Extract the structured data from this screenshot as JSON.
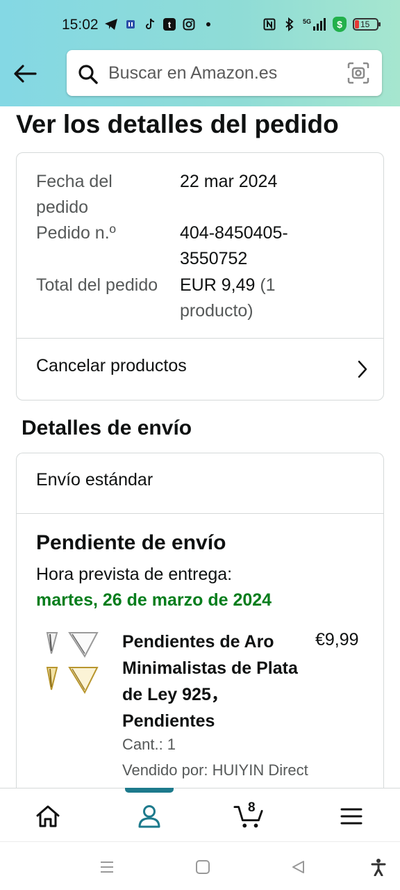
{
  "status_bar": {
    "time": "15:02",
    "battery": "15"
  },
  "search": {
    "placeholder": "Buscar en Amazon.es"
  },
  "page_title": "Ver los detalles del pedido",
  "order_summary": {
    "rows": [
      {
        "label": "Fecha del pedido",
        "value": "22 mar 2024"
      },
      {
        "label": "Pedido n.º",
        "value": "404-8450405-3550752"
      },
      {
        "label": "Total del pedido",
        "value": "EUR 9,49",
        "value_tail": " (1 producto)"
      }
    ],
    "cancel_label": "Cancelar productos"
  },
  "shipping": {
    "section_title": "Detalles de envío",
    "method": "Envío estándar",
    "status": "Pendiente de envío",
    "eta_label": "Hora prevista de entrega:",
    "eta_date": "martes, 26 de marzo de 2024",
    "status_color": "#067d1c"
  },
  "product": {
    "title": "Pendientes de Aro Minimalistas de Plata de Ley 925，Pendientes",
    "price": "€9,99",
    "quantity": "Cant.: 1",
    "seller": "Vendido por: HUIYIN Direct"
  },
  "bottom_nav": {
    "items": [
      {
        "icon": "home-icon"
      },
      {
        "icon": "account-icon",
        "active": true
      },
      {
        "icon": "cart-icon"
      },
      {
        "icon": "menu-icon"
      }
    ],
    "cart_count": "8",
    "accent_color": "#1d7a8c"
  }
}
